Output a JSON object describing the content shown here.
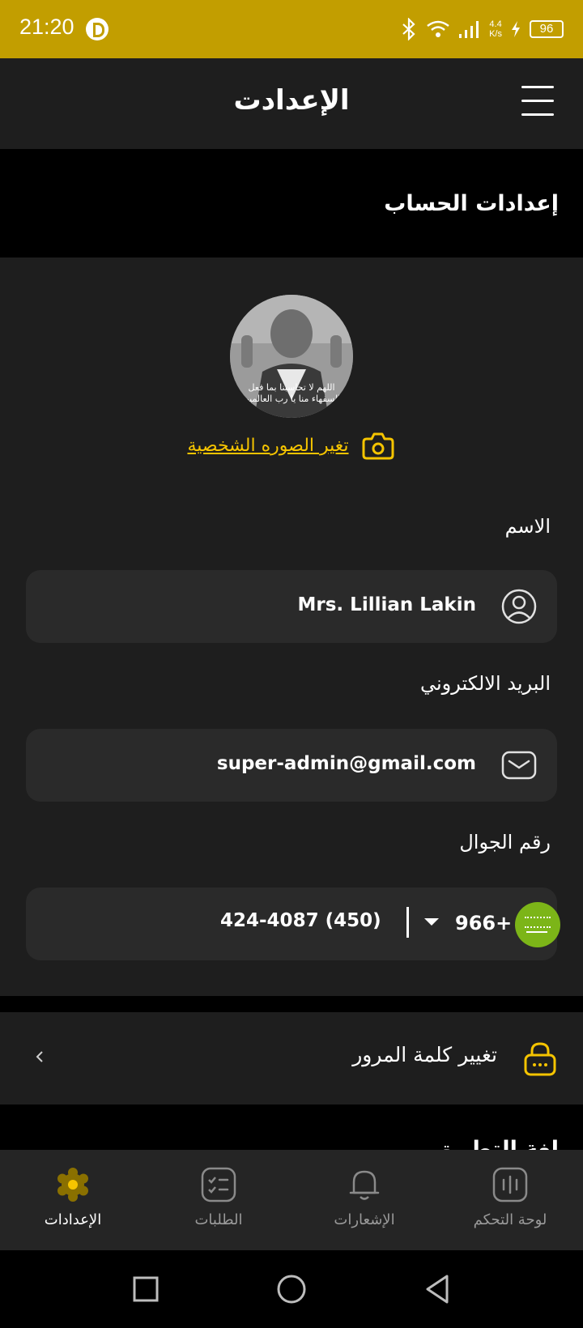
{
  "status_bar": {
    "time": "21:20",
    "speed_top": "4.4",
    "speed_bottom": "K/s",
    "battery": "96",
    "icons": [
      "bluetooth-icon",
      "wifi-icon",
      "signal-icon",
      "charging-icon"
    ]
  },
  "header": {
    "title": "الإعدادت",
    "menu_icon": "hamburger-menu-icon"
  },
  "account_section": {
    "title": "إعدادات الحساب"
  },
  "profile": {
    "avatar_caption_line1": "اللهم لا تحاسبنا بما فعل",
    "avatar_caption_line2": "السفهاء منا يا رب العالمين",
    "change_photo_label": "تغير الصوره الشخصية"
  },
  "fields": {
    "name_label": "الاسم",
    "name_value": "Mrs. Lillian Lakin",
    "email_label": "البريد الالكتروني",
    "email_value": "super-admin@gmail.com",
    "phone_label": "رقم الجوال",
    "phone_code": "966+",
    "phone_number": "424-4087 (450)"
  },
  "password": {
    "label": "تغيير كلمة المرور"
  },
  "next_section": {
    "title_partial": "لغة التطبيق"
  },
  "bottom_nav": {
    "items": [
      {
        "label": "لوحة التحكم",
        "icon": "dashboard-icon"
      },
      {
        "label": "الإشعارات",
        "icon": "bell-icon"
      },
      {
        "label": "الطلبات",
        "icon": "orders-icon"
      },
      {
        "label": "الإعدادات",
        "icon": "settings-gear-icon",
        "active": true
      }
    ]
  },
  "colors": {
    "accent": "#f5c400",
    "status_bar": "#c29e00",
    "surface": "#1e1e1e",
    "field": "#2a2a2a",
    "background": "#000000"
  }
}
